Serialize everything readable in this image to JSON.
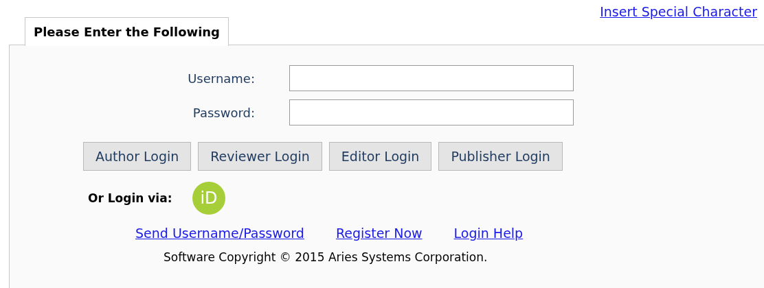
{
  "header_link": "Insert Special Character",
  "tab": {
    "label": "Please Enter the Following"
  },
  "fields": [
    {
      "label": "Username:"
    },
    {
      "label": "Password:"
    }
  ],
  "buttons": [
    "Author Login",
    "Reviewer Login",
    "Editor Login",
    "Publisher Login"
  ],
  "alt_login": {
    "label": "Or Login via:",
    "icon_text": "iD"
  },
  "links": [
    "Send Username/Password",
    "Register Now",
    "Login Help"
  ],
  "copyright": "Software Copyright © 2015 Aries Systems Corporation."
}
